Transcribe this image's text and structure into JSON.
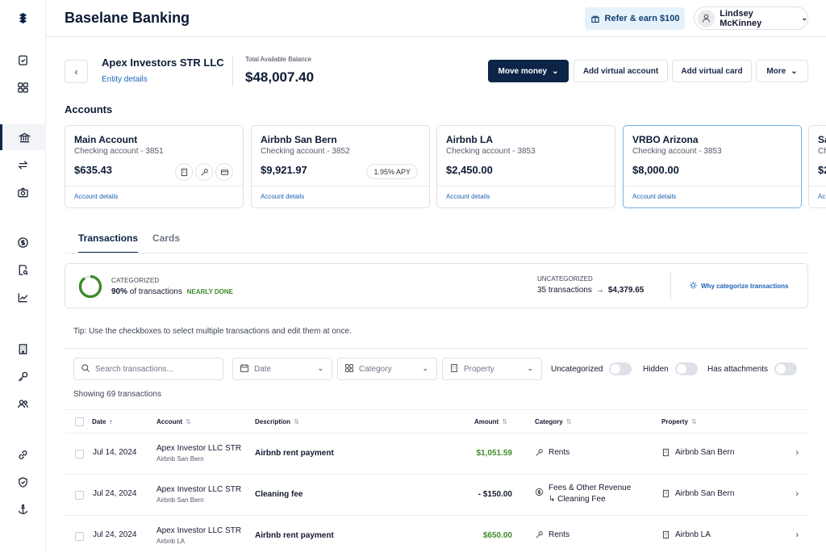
{
  "app": {
    "title": "Baselane Banking"
  },
  "header": {
    "refer_label": "Refer & earn $100",
    "user_name": "Lindsey McKinney"
  },
  "entity": {
    "name": "Apex Investors STR LLC",
    "details_link": "Entity details",
    "balance_label": "Total Available Balance",
    "balance": "$48,007.40"
  },
  "actions": {
    "move_money": "Move money",
    "add_virtual_account": "Add virtual account",
    "add_virtual_card": "Add virtual card",
    "more": "More"
  },
  "accounts": {
    "title": "Accounts",
    "items": [
      {
        "name": "Main Account",
        "sub": "Checking account - 3851",
        "balance": "$635.43",
        "link": "Account details"
      },
      {
        "name": "Airbnb San Bern",
        "sub": "Checking account - 3852",
        "balance": "$9,921.97",
        "apy": "1.95% APY",
        "link": "Account details"
      },
      {
        "name": "Airbnb LA",
        "sub": "Checking account - 3853",
        "balance": "$2,450.00",
        "link": "Account details"
      },
      {
        "name": "VRBO Arizona",
        "sub": "Checking account - 3853",
        "balance": "$8,000.00",
        "link": "Account details"
      },
      {
        "name": "Sa",
        "sub": "Ch",
        "balance": "$2",
        "link": "Ac"
      }
    ]
  },
  "tabs": [
    {
      "label": "Transactions"
    },
    {
      "label": "Cards"
    }
  ],
  "categorized": {
    "label": "CATEGORIZED",
    "percent_text": "90%",
    "of_text": "of transactions",
    "status": "NEARLY DONE",
    "progress": 0.9
  },
  "uncategorized": {
    "label": "UNCATEGORIZED",
    "count_text": "35 transactions",
    "amount": "$4,379.65"
  },
  "why_link": "Why categorize transactions",
  "tip": "Tip: Use the checkboxes to select multiple transactions and edit them at once.",
  "filters": {
    "search_placeholder": "Search transactions...",
    "date": "Date",
    "category": "Category",
    "property": "Property",
    "uncategorized": "Uncategorized",
    "hidden": "Hidden",
    "has_attachments": "Has attachments"
  },
  "showing": "Showing 69 transactions",
  "table": {
    "headers": {
      "date": "Date",
      "account": "Account",
      "description": "Description",
      "amount": "Amount",
      "category": "Category",
      "property": "Property"
    },
    "rows": [
      {
        "date": "Jul 14, 2024",
        "account": "Apex Investor LLC STR",
        "account_sub": "Airbnb San Bern",
        "description": "Airbnb rent payment",
        "amount": "$1,051.59",
        "category": "Rents",
        "property": "Airbnb San Bern"
      },
      {
        "date": "Jul 24, 2024",
        "account": "Apex Investor LLC STR",
        "account_sub": "Airbnb San Bern",
        "description": "Cleaning fee",
        "amount": "- $150.00",
        "category": "Fees & Other Revenue",
        "category_sub": "↳ Cleaning Fee",
        "property": "Airbnb San Bern"
      },
      {
        "date": "Jul 24, 2024",
        "account": "Apex Investor LLC STR",
        "account_sub": "Airbnb LA",
        "description": "Airbnb rent payment",
        "amount": "$650.00",
        "category": "Rents",
        "property": "Airbnb LA"
      }
    ]
  },
  "colors": {
    "primary": "#0b2447",
    "link": "#1c63b8",
    "positive": "#3f8a2a",
    "refer_bg": "#e6f2fb"
  },
  "icons": [
    "logo-icon",
    "checklist-icon",
    "dashboard-icon",
    "bank-icon",
    "transfer-icon",
    "camera-icon",
    "dollar-icon",
    "search-doc-icon",
    "chart-icon",
    "building-icon",
    "key-icon",
    "users-icon",
    "link-icon",
    "shield-icon",
    "anchor-icon"
  ]
}
